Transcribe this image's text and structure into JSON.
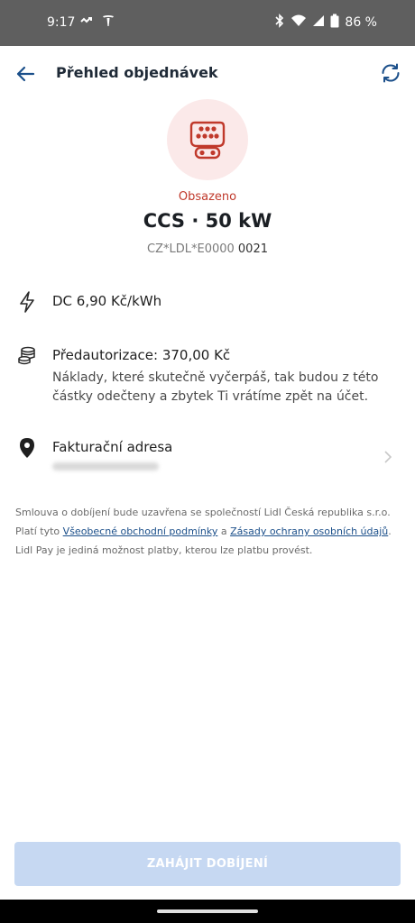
{
  "status_bar": {
    "time": "9:17",
    "battery": "86 %"
  },
  "header": {
    "title": "Přehled objednávek"
  },
  "connector": {
    "status": "Obsazeno",
    "title": "CCS · 50 kW",
    "evse_id_prefix": "CZ*LDL*E0000",
    "evse_id_suffix": " 0021"
  },
  "details": {
    "price": "DC  6,90 Kč/kWh",
    "preauth_title": "Předautorizace: 370,00 Kč",
    "preauth_desc": "Náklady, které skutečně vyčerpáš, tak budou z této částky odečteny a zbytek Ti vrátíme zpět na účet.",
    "billing_title": "Fakturační adresa"
  },
  "legal": {
    "line1": "Smlouva o dobíjení bude uzavřena se společností Lidl Česká republika s.r.o.",
    "line2_prefix": "Platí tyto ",
    "terms_link": "Všeobecné obchodní podmínky",
    "line2_mid": " a ",
    "privacy_link": "Zásady ochrany osobních údajů",
    "line2_suffix": ".",
    "line3": "Lidl Pay je jediná možnost platby, kterou lze platbu provést."
  },
  "actions": {
    "start_label": "ZAHÁJIT DOBÍJENÍ"
  },
  "colors": {
    "accent": "#1b4f8a",
    "status_busy": "#c0392b",
    "button_disabled": "#c6d8f2"
  }
}
